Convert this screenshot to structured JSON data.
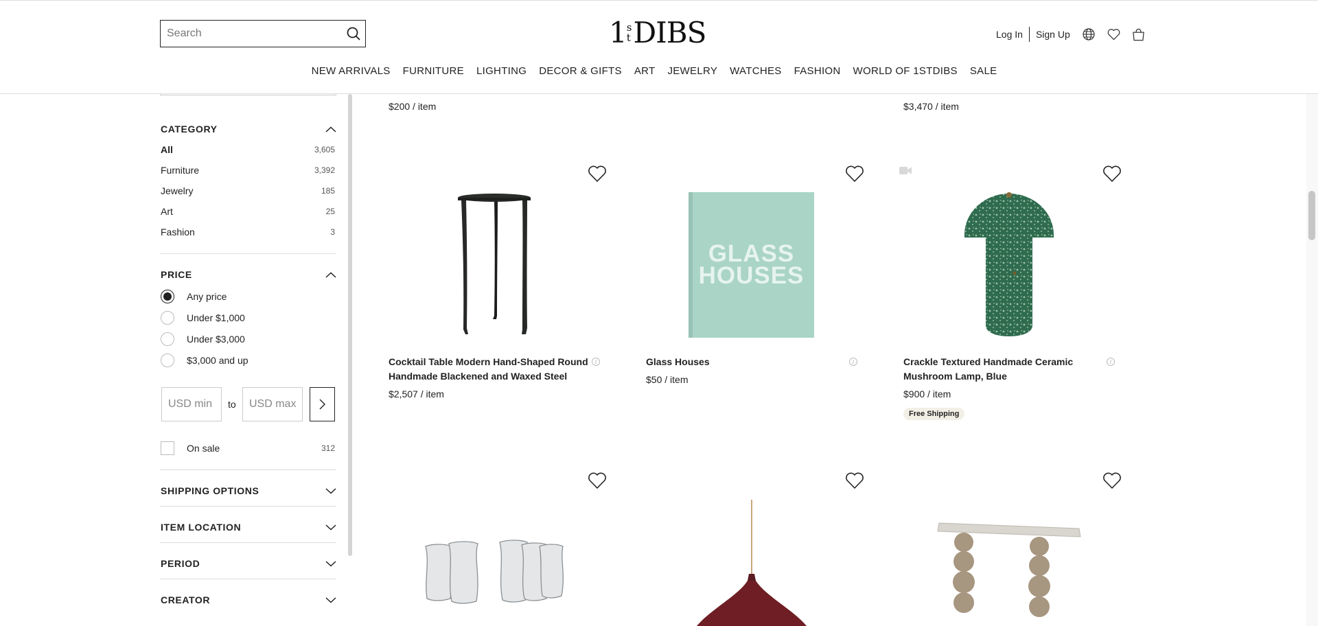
{
  "header": {
    "search_placeholder": "Search",
    "logo_one": "1",
    "logo_s": "s",
    "logo_t": "t",
    "logo_dibs": "DIBS",
    "login": "Log In",
    "signup": "Sign Up"
  },
  "nav": [
    "NEW ARRIVALS",
    "FURNITURE",
    "LIGHTING",
    "DECOR & GIFTS",
    "ART",
    "JEWELRY",
    "WATCHES",
    "FASHION",
    "WORLD OF 1STDIBS",
    "SALE"
  ],
  "sidebar": {
    "category_title": "CATEGORY",
    "categories": [
      {
        "label": "All",
        "count": "3,605"
      },
      {
        "label": "Furniture",
        "count": "3,392"
      },
      {
        "label": "Jewelry",
        "count": "185"
      },
      {
        "label": "Art",
        "count": "25"
      },
      {
        "label": "Fashion",
        "count": "3"
      }
    ],
    "price_title": "PRICE",
    "price_options": [
      "Any price",
      "Under $1,000",
      "Under $3,000",
      "$3,000 and up"
    ],
    "selected_price": "Any price",
    "min_placeholder": "USD min",
    "to_label": "to",
    "max_placeholder": "USD max",
    "on_sale_label": "On sale",
    "on_sale_count": "312",
    "collapsed_sections": [
      "SHIPPING OPTIONS",
      "ITEM LOCATION",
      "PERIOD",
      "CREATOR"
    ]
  },
  "top_row_prices": [
    "$200 / item",
    "$3,470 / item"
  ],
  "products": [
    {
      "title_line1": "Cocktail Table Modern Hand-Shaped Round",
      "title_line2": "Handmade Blackened and Waxed Steel",
      "price": "$2,507 / item"
    },
    {
      "title_line1": "Glass Houses",
      "title_line2": "",
      "price": "$50 / item",
      "cover_text_1": "GLASS",
      "cover_text_2": "HOUSES"
    },
    {
      "title_line1": "Crackle Textured Handmade Ceramic",
      "title_line2": "Mushroom Lamp, Blue",
      "price": "$900 / item",
      "badge": "Free Shipping"
    }
  ],
  "colors": {
    "text": "#222222",
    "badge_bg": "#f2f0e6",
    "book_cover": "#a9d4c6",
    "lamp_green": "#2f6b4f",
    "pendant_red": "#6e1e24"
  }
}
